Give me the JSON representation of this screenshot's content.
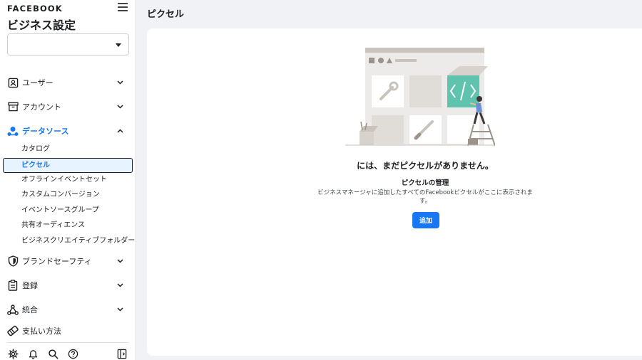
{
  "sidebar": {
    "brand": "FACEBOOK",
    "title": "ビジネス設定",
    "business_select_value": "",
    "items": [
      {
        "label": "ユーザー",
        "icon": "user-badge-icon"
      },
      {
        "label": "アカウント",
        "icon": "archive-box-icon"
      },
      {
        "label": "データソース",
        "icon": "data-source-icon"
      },
      {
        "label": "ブランドセーフティ",
        "icon": "shield-icon"
      },
      {
        "label": "登録",
        "icon": "clipboard-icon"
      },
      {
        "label": "統合",
        "icon": "integration-icon"
      },
      {
        "label": "支払い方法",
        "icon": "tag-icon"
      }
    ],
    "data_source_sub": [
      "カタログ",
      "ピクセル",
      "オフラインイベントセット",
      "カスタムコンバージョン",
      "イベントソースグループ",
      "共有オーディエンス",
      "ビジネスクリエイティブフォルダー"
    ],
    "bottom_icons": [
      "gear-icon",
      "bell-icon",
      "search-icon",
      "help-icon",
      "panel-toggle-icon"
    ]
  },
  "main": {
    "page_title": "ピクセル",
    "empty_title": "には、まだピクセルがありません。",
    "empty_subtitle": "ピクセルの管理",
    "empty_description": "ビジネスマネージャに追加したすべてのFacebookピクセルがここに表示されます。",
    "add_button": "追加"
  },
  "colors": {
    "accent": "#1877f2",
    "selected_bg": "#e7f3ff",
    "page_bg": "#f0f2f5",
    "teal": "#5fc3ad"
  }
}
